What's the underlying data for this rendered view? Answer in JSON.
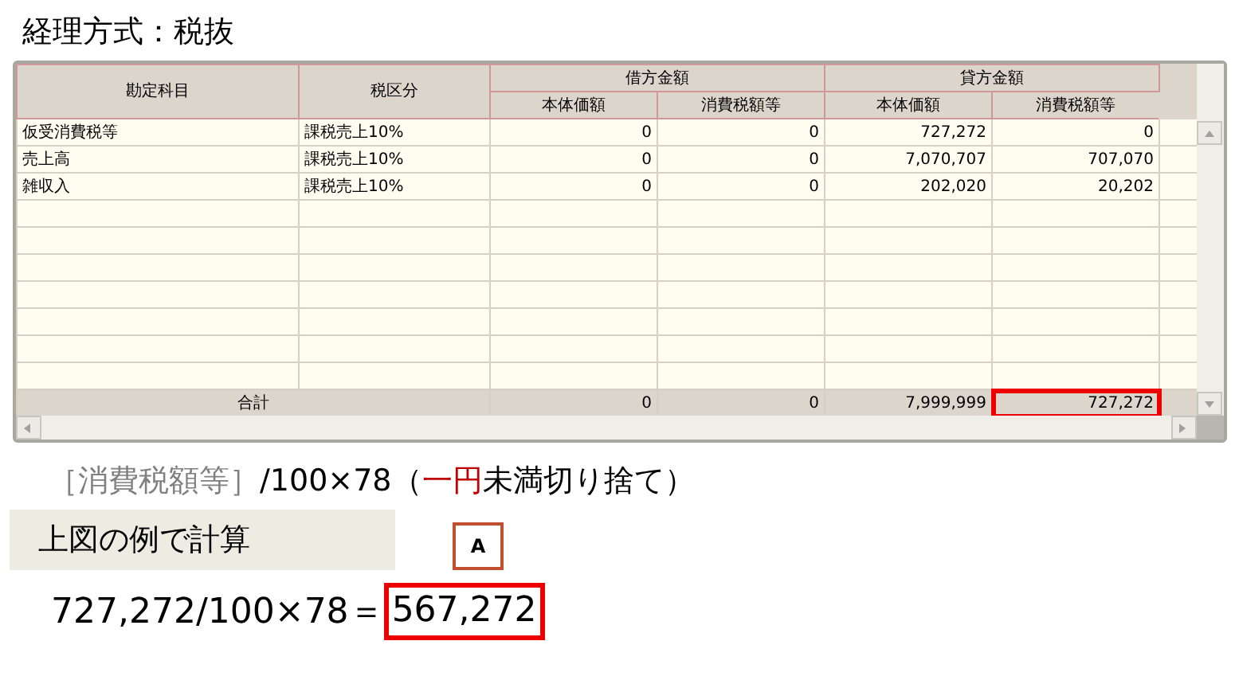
{
  "title": "経理方式：税抜",
  "grid": {
    "columns": [
      "勘定科目",
      "税区分"
    ],
    "groups": [
      {
        "label": "借方金額",
        "subcolumns": [
          "本体価額",
          "消費税額等"
        ]
      },
      {
        "label": "貸方金額",
        "subcolumns": [
          "本体価額",
          "消費税額等"
        ]
      }
    ],
    "rows": [
      {
        "account": "仮受消費税等",
        "tax_class": "課税売上10%",
        "values": [
          "0",
          "0",
          "727,272",
          "0"
        ]
      },
      {
        "account": "売上高",
        "tax_class": "課税売上10%",
        "values": [
          "0",
          "0",
          "7,070,707",
          "707,070"
        ]
      },
      {
        "account": "雑収入",
        "tax_class": "課税売上10%",
        "values": [
          "0",
          "0",
          "202,020",
          "20,202"
        ]
      }
    ],
    "total": {
      "label": "合計",
      "values": [
        {
          "text": "0",
          "highlighted": false
        },
        {
          "text": "0",
          "highlighted": false
        },
        {
          "text": "7,999,999",
          "highlighted": false
        },
        {
          "text": "727,272",
          "highlighted": true
        }
      ]
    }
  },
  "formula": [
    {
      "text": "［消費税額等］",
      "kind": "muted"
    },
    {
      "text": "/100×78（",
      "kind": "plain"
    },
    {
      "text": "一円",
      "kind": "accent"
    },
    {
      "text": "未満切り捨て）",
      "kind": "plain"
    }
  ],
  "example": {
    "heading": "上図の例で計算",
    "marker": "A",
    "expression": "727,272/100×78＝",
    "result": "567,272",
    "result_highlighted": true
  }
}
